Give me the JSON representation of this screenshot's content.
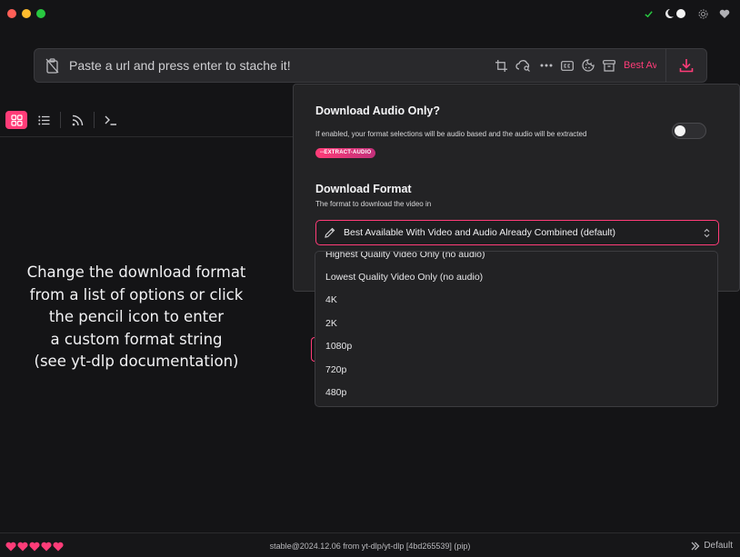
{
  "colors": {
    "accent": "#ff3c78",
    "background": "#141416",
    "panel": "#232325"
  },
  "window": {
    "controls": [
      "close",
      "minimize",
      "maximize"
    ]
  },
  "header": {
    "icons": [
      "check-icon",
      "theme-toggle-icon",
      "gear-icon",
      "heart-icon"
    ]
  },
  "urlbar": {
    "placeholder": "Paste a url and press enter to stache it!",
    "tools": [
      "crop-icon",
      "cloud-search-icon",
      "more-icon",
      "captions-icon",
      "cookie-icon",
      "archive-icon"
    ],
    "format_label": "Best Av",
    "download_icon": "download-icon"
  },
  "viewbar": {
    "items": [
      "grid-view-icon",
      "list-view-icon",
      "rss-icon",
      "terminal-icon"
    ],
    "active": "grid-view-icon"
  },
  "caption": {
    "lines": [
      "Change the download format",
      "from a list of options or click",
      "the pencil icon to enter",
      "a custom format string",
      "(see yt-dlp documentation)"
    ]
  },
  "settings": {
    "audio": {
      "title": "Download Audio Only?",
      "description": "If enabled, your format selections will be audio based and the audio will be extracted",
      "badge": "--EXTRACT-AUDIO",
      "enabled": false
    },
    "format": {
      "title": "Download Format",
      "description": "The format to download the video in",
      "selected": "Best Available With Video and Audio Already Combined (default)",
      "options": [
        "Highest Quality Video Only (no audio)",
        "Lowest Quality Video Only (no audio)",
        "4K",
        "2K",
        "1080p",
        "720p",
        "480p"
      ]
    }
  },
  "footer": {
    "hearts": 5,
    "version": "stable@2024.12.06 from yt-dlp/yt-dlp [4bd265539] (pip)",
    "profile": "Default"
  }
}
